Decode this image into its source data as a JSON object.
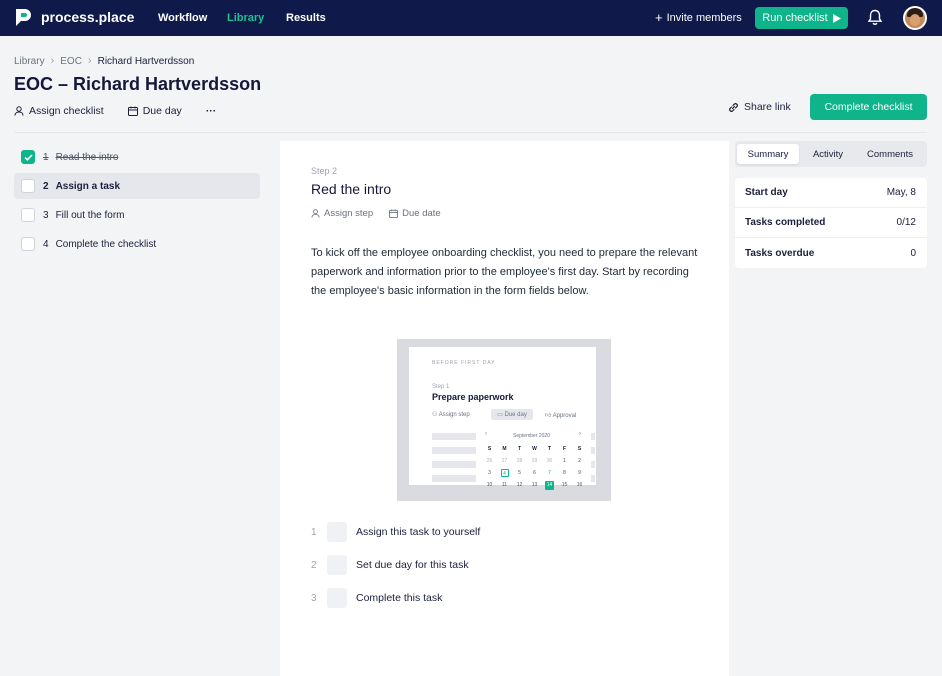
{
  "topbar": {
    "logo_text": "process.place",
    "nav": [
      "Workflow",
      "Library",
      "Results"
    ],
    "active_nav": "Library",
    "invite_label": "Invite members",
    "run_label": "Run checklist"
  },
  "breadcrumb": [
    "Library",
    "EOC",
    "Richard Hartverdsson"
  ],
  "page_title": "EOC – Richard Hartverdsson",
  "toolbar": {
    "assign_label": "Assign checklist",
    "due_label": "Due day",
    "more_label": "···",
    "share_label": "Share link",
    "complete_label": "Complete checklist"
  },
  "tasks": [
    {
      "num": "1",
      "label": "Read the intro",
      "done": true
    },
    {
      "num": "2",
      "label": "Assign a task",
      "selected": true
    },
    {
      "num": "3",
      "label": "Fill out the form"
    },
    {
      "num": "4",
      "label": "Complete the checklist"
    }
  ],
  "step": {
    "label": "Step 2",
    "title": "Red the intro",
    "assign_label": "Assign step",
    "due_label": "Due date",
    "description": "To kick off the employee onboarding checklist, you need to prepare the relevant paperwork and information prior to the employee's first day. Start by recording the employee's basic information in the form fields below."
  },
  "preview": {
    "section_label": "BEFORE FIRST DAY",
    "step_label": "Step 1",
    "title": "Prepare paperwork",
    "assign_label": "Assign step",
    "due_label": "Due day",
    "approval_label": "Approval",
    "month": "September 2020",
    "weekdays": [
      "S",
      "M",
      "T",
      "W",
      "T",
      "F",
      "S"
    ],
    "weeks": [
      [
        "26",
        "27",
        "28",
        "29",
        "30",
        "1",
        "2"
      ],
      [
        "3",
        "4",
        "5",
        "6",
        "7",
        "8",
        "9"
      ],
      [
        "10",
        "11",
        "12",
        "13",
        "14",
        "15",
        "16"
      ]
    ]
  },
  "todos": [
    {
      "num": "1",
      "label": "Assign this task to yourself"
    },
    {
      "num": "2",
      "label": "Set due day for this task"
    },
    {
      "num": "3",
      "label": "Complete this task"
    }
  ],
  "side": {
    "tabs": [
      "Summary",
      "Activity",
      "Comments"
    ],
    "active_tab": "Summary",
    "rows": [
      {
        "key": "Start day",
        "value": "May, 8"
      },
      {
        "key": "Tasks completed",
        "value": "0/12"
      },
      {
        "key": "Tasks overdue",
        "value": "0"
      }
    ]
  },
  "colors": {
    "navy": "#0f1a4a",
    "accent": "#10b48a"
  }
}
